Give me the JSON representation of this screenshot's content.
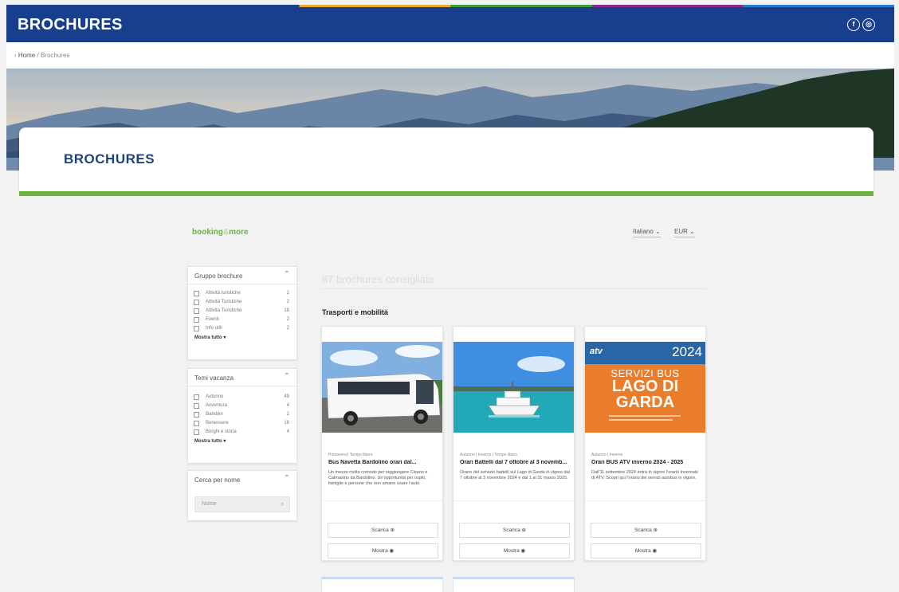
{
  "header": {
    "title": "BROCHURES",
    "social": [
      {
        "icon": "facebook-icon",
        "glyph": "f"
      },
      {
        "icon": "instagram-icon",
        "glyph": "◎"
      }
    ]
  },
  "breadcrumb": {
    "home": "Home",
    "separator": "/",
    "current": "Brochures"
  },
  "page": {
    "title": "BROCHURES"
  },
  "brand": {
    "main": "booking",
    "amp": "&",
    "suffix": "more"
  },
  "selectors": {
    "language": "Italiano",
    "currency": "EUR"
  },
  "filters": [
    {
      "title": "Gruppo brochure",
      "options": [
        {
          "label": "Attività turistiche",
          "count": "2"
        },
        {
          "label": "Attività Turistiche",
          "count": "2"
        },
        {
          "label": "Attività Turistiche",
          "count": "18"
        },
        {
          "label": "Eventi",
          "count": "2"
        },
        {
          "label": "Info utili",
          "count": "2"
        }
      ],
      "more": "Mostra tutto"
    },
    {
      "title": "Temi vacanza",
      "options": [
        {
          "label": "Autunno",
          "count": "49"
        },
        {
          "label": "Avventura",
          "count": "4"
        },
        {
          "label": "Bambini",
          "count": "2"
        },
        {
          "label": "Benessere",
          "count": "18"
        },
        {
          "label": "Borghi e storia",
          "count": "4"
        }
      ],
      "more": "Mostra tutto"
    }
  ],
  "search": {
    "title": "Cerca per nome",
    "placeholder": "Nome"
  },
  "results": {
    "count_text": "87 brochures consigliate",
    "category": "Trasporti e mobilità"
  },
  "cards": [
    {
      "meta": "Primavera | Tempo libero",
      "title": "Bus Navetta Bardolino orari dal...",
      "desc": "Un mezzo molto comodo per raggiungere Cisano e Calmasino da Bardolino. Un'opportunità per ospiti, famiglie e persone che non amano usare l'auto.",
      "download": "Scarica",
      "view": "Mostra"
    },
    {
      "meta": "Autunno | Inverno | Tempo libero",
      "title": "Orari Battelli dal 7 ottobre al 3 novemb...",
      "desc": "Orario del servizio battelli sul Lago di Garda in vigore dal 7 ottobre al 3 novembre 2024 e dal 1 al 31 marzo 2025.",
      "download": "Scarica",
      "view": "Mostra"
    },
    {
      "meta": "Autunno | Inverno",
      "title": "Orari BUS ATV inverno 2024 - 2025",
      "desc": "Dall'11 settembre 2024 entra in vigore l'orario invernale di ATV. Scopri qui l'orario dei servizi autobus in vigore.",
      "download": "Scarica",
      "view": "Mostra"
    }
  ],
  "poster": {
    "brand": "atv",
    "year": "2024",
    "lines": [
      "SERVIZI BUS",
      "LAGO DI",
      "GARDA"
    ],
    "color": "#e97d2b"
  },
  "colors": {
    "header": "#183f8e",
    "accent_green": "#6cb33f",
    "title_blue": "#1e4478"
  }
}
